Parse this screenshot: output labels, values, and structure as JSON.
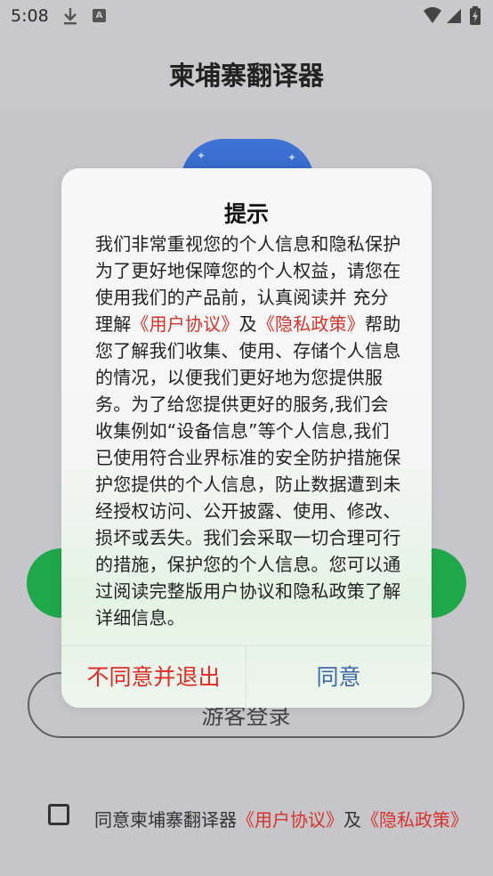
{
  "status_bar": {
    "time": "5:08",
    "download_icon": "download-icon",
    "a_icon": "A"
  },
  "app_bar": {
    "title": "柬埔寨翻译器"
  },
  "background": {
    "guest_login_label": "游客登录"
  },
  "agreement": {
    "prefix": "同意柬埔寨翻译器",
    "user_agreement": "《用户协议》",
    "and": "及",
    "privacy_policy": "《隐私政策》"
  },
  "dialog": {
    "title": "提示",
    "body_1": "我们非常重视您的个人信息和隐私保护为了更好地保障您的个人权益，请您在使用我们的产品前，认真阅读并  充分理解",
    "link_user_agreement": "《用户协议》",
    "and": "及",
    "link_privacy_policy": "《隐私政策》",
    "body_2": "帮助您了解我们收集、使用、存储个人信息的情况，以便我们更好地为您提供服务。为了给您提供更好的服务,我们会收集例如“设备信息”等个人信息,我们已使用符合业界标准的安全防护措施保护您提供的个人信息，防止数据遭到未经授权访问、公开披露、使用、修改、损坏或丢失。我们会采取一切合理可行的措施，保护您的个人信息。您可以通过阅读完整版用户协议和隐私政策了解详细信息。",
    "disagree_button": "不同意并退出",
    "agree_button": "同意"
  },
  "colors": {
    "link_red": "#d8322c",
    "agree_blue": "#3c6aa6",
    "brand_green": "#1fa84a"
  }
}
